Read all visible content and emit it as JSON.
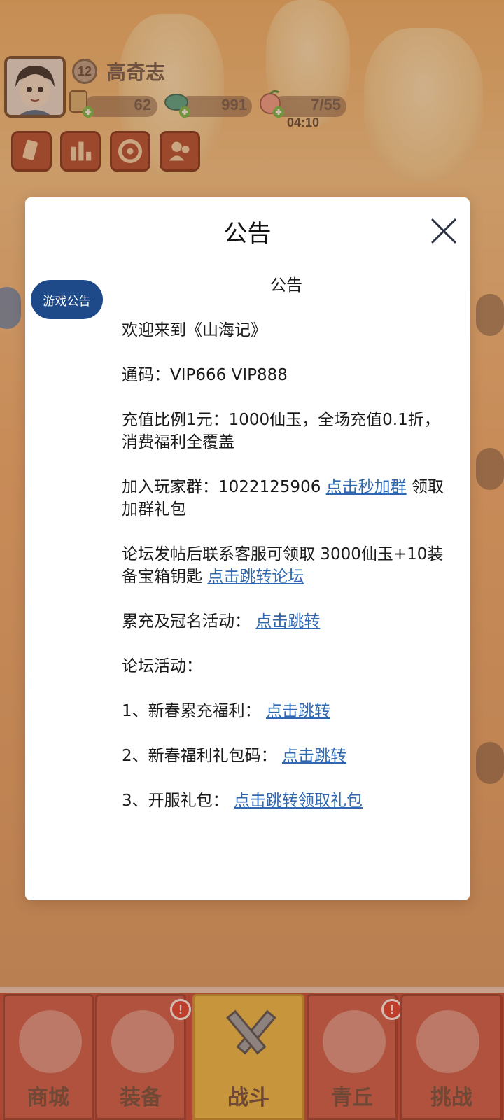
{
  "player": {
    "level": "12",
    "name": "高奇志",
    "resources": [
      {
        "icon": "ticket-icon",
        "value": "62"
      },
      {
        "icon": "fish-icon",
        "value": "991"
      },
      {
        "icon": "peach-icon",
        "value": "7/55"
      }
    ],
    "timer": "04:10"
  },
  "hud_buttons": [
    "card-icon",
    "ranking-icon",
    "settings-icon",
    "friends-icon"
  ],
  "modal": {
    "title": "公告",
    "side_tab": "游戏公告",
    "content_title": "公告",
    "lines": {
      "welcome": "欢迎来到《山海记》",
      "codes": "通码：VIP666 VIP888",
      "recharge": "充值比例1元：1000仙玉，全场充值0.1折，消费福利全覆盖",
      "group_prefix": "加入玩家群：1022125906 ",
      "group_link": "点击秒加群",
      "group_suffix": " 领取加群礼包",
      "forum_prefix": "论坛发帖后联系客服可领取 3000仙玉+10装备宝箱钥匙 ",
      "forum_link": "点击跳转论坛",
      "event_prefix": "累充及冠名活动：",
      "event_link": "点击跳转",
      "forum_events": "论坛活动：",
      "item1_prefix": "1、新春累充福利：",
      "item1_link": "点击跳转",
      "item2_prefix": "2、新春福利礼包码：",
      "item2_link": "点击跳转",
      "item3_prefix": "3、开服礼包：",
      "item3_link": "点击跳转领取礼包"
    }
  },
  "bottom_nav": [
    {
      "label": "商城",
      "active": false,
      "badge": false
    },
    {
      "label": "装备",
      "active": false,
      "badge": true
    },
    {
      "label": "战斗",
      "active": true,
      "badge": false
    },
    {
      "label": "青丘",
      "active": false,
      "badge": true
    },
    {
      "label": "挑战",
      "active": false,
      "badge": false
    }
  ],
  "colors": {
    "accent": "#1e4a8a",
    "link": "#2f68b0",
    "nav_active": "#f1c045"
  }
}
